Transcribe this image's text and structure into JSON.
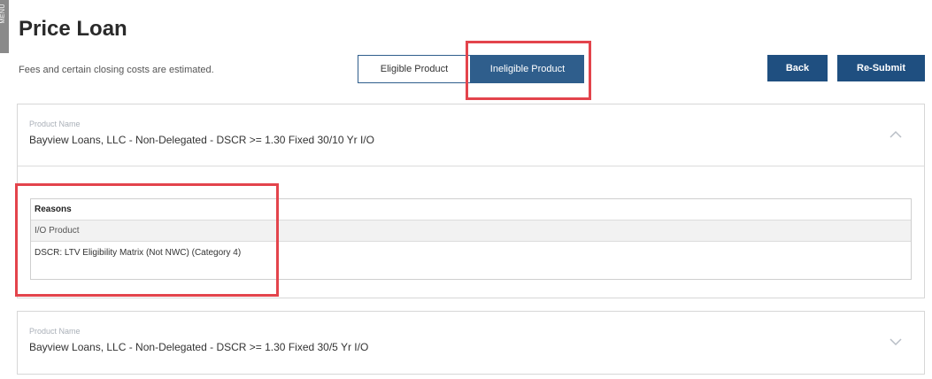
{
  "menu_tab_label": "MENU",
  "page": {
    "title": "Price Loan",
    "subtitle": "Fees and certain closing costs are estimated."
  },
  "toggle": {
    "eligible_label": "Eligible Product",
    "ineligible_label": "Ineligible Product",
    "selected": "Ineligible Product"
  },
  "actions": {
    "back_label": "Back",
    "resubmit_label": "Re-Submit"
  },
  "products": [
    {
      "label": "Product Name",
      "name": "Bayview Loans, LLC - Non-Delegated - DSCR >= 1.30 Fixed 30/10 Yr I/O",
      "expanded": true,
      "reasons_header": "Reasons",
      "reasons": [
        "I/O Product",
        "DSCR: LTV Eligibility Matrix (Not NWC) (Category 4)"
      ]
    },
    {
      "label": "Product Name",
      "name": "Bayview Loans, LLC - Non-Delegated - DSCR >= 1.30 Fixed 30/5 Yr I/O",
      "expanded": false
    }
  ],
  "colors": {
    "primary": "#1f4f80",
    "toggle_active": "#2f5e8c",
    "highlight": "#e3444c"
  }
}
